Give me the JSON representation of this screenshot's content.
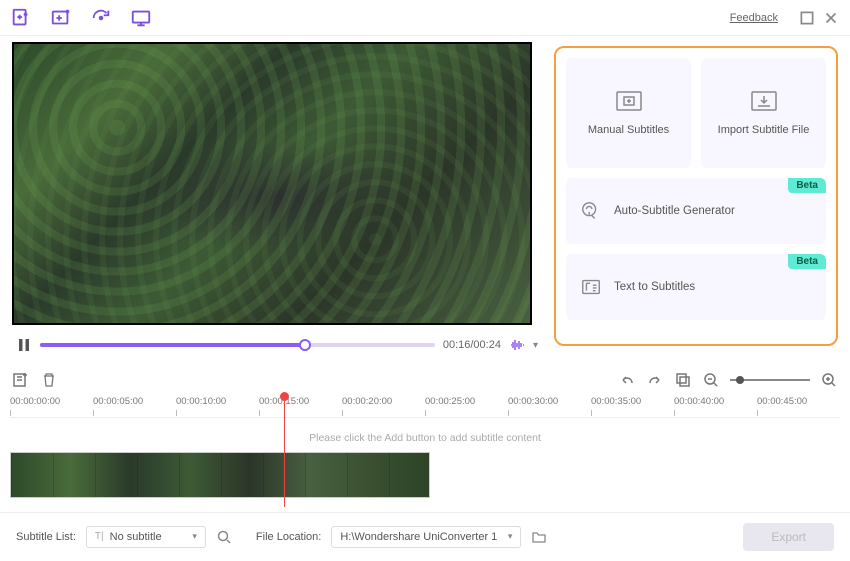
{
  "titlebar": {
    "feedback": "Feedback"
  },
  "player": {
    "time": "00:16/00:24",
    "progress_pct": 67
  },
  "options": {
    "manual": "Manual Subtitles",
    "import": "Import Subtitle File",
    "auto": "Auto-Subtitle Generator",
    "tts": "Text to Subtitles",
    "beta": "Beta"
  },
  "timeline": {
    "ticks": [
      "00:00:00:00",
      "00:00:05:00",
      "00:00:10:00",
      "00:00:15:00",
      "00:00:20:00",
      "00:00:25:00",
      "00:00:30:00",
      "00:00:35:00",
      "00:00:40:00",
      "00:00:45:00"
    ],
    "hint": "Please click the Add button to add subtitle content",
    "playhead_pct": 33
  },
  "bottom": {
    "subtitle_list_label": "Subtitle List:",
    "subtitle_list_value": "No subtitle",
    "file_location_label": "File Location:",
    "file_location_value": "H:\\Wondershare UniConverter 1",
    "export": "Export"
  }
}
